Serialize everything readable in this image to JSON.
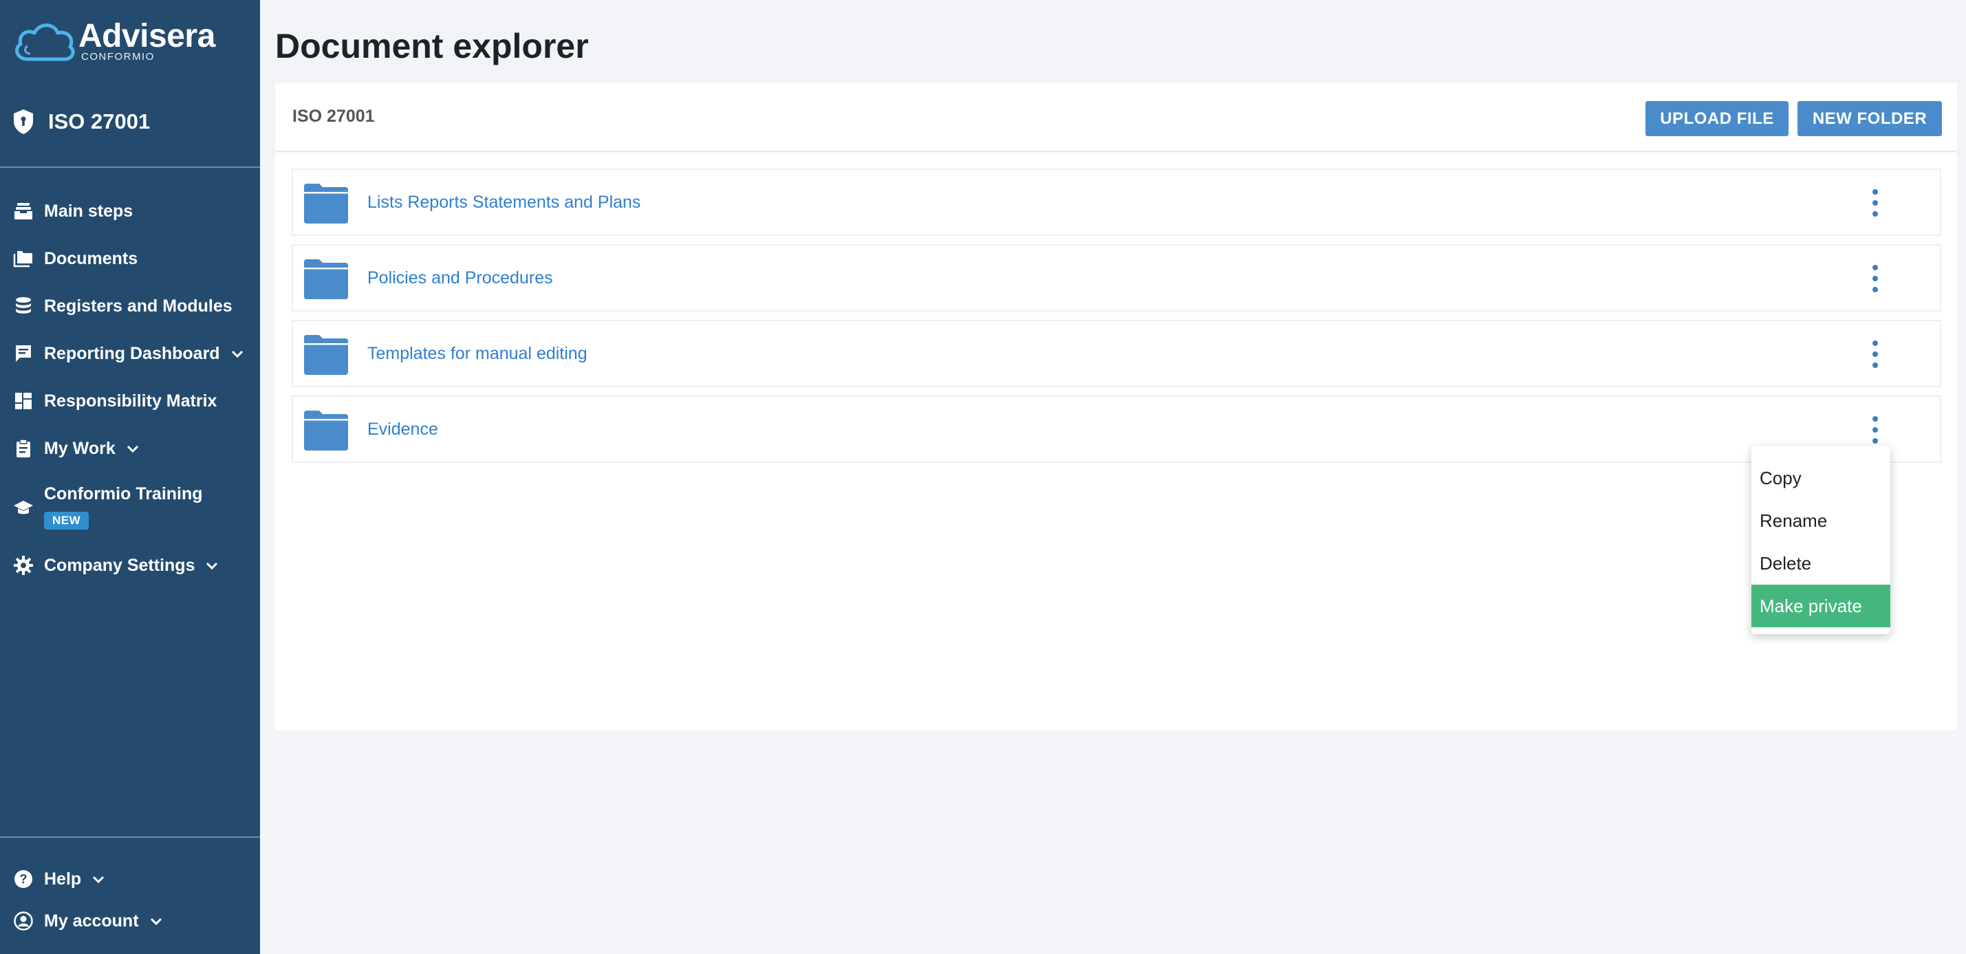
{
  "brand": {
    "name": "Advisera",
    "sub": "CONFORMIO"
  },
  "standard": "ISO 27001",
  "nav": {
    "main_steps": "Main steps",
    "documents": "Documents",
    "registers": "Registers and Modules",
    "reporting": "Reporting Dashboard",
    "responsibility": "Responsibility Matrix",
    "my_work": "My Work",
    "training": "Conformio Training",
    "training_badge": "NEW",
    "company_settings": "Company Settings",
    "help": "Help",
    "my_account": "My account"
  },
  "page": {
    "title": "Document explorer"
  },
  "toolbar": {
    "breadcrumb": "ISO 27001",
    "upload_label": "UPLOAD FILE",
    "new_folder_label": "NEW FOLDER"
  },
  "folders": [
    {
      "name": "Lists Reports Statements and Plans"
    },
    {
      "name": "Policies and Procedures"
    },
    {
      "name": "Templates for manual editing"
    },
    {
      "name": "Evidence"
    }
  ],
  "context_menu": {
    "items": [
      "Copy",
      "Rename",
      "Delete",
      "Make private"
    ],
    "highlighted": "Make private"
  },
  "colors": {
    "sidebar": "#244b6e",
    "accent": "#4a8ccb",
    "link": "#2f7fd0",
    "highlight": "#45b77e"
  }
}
